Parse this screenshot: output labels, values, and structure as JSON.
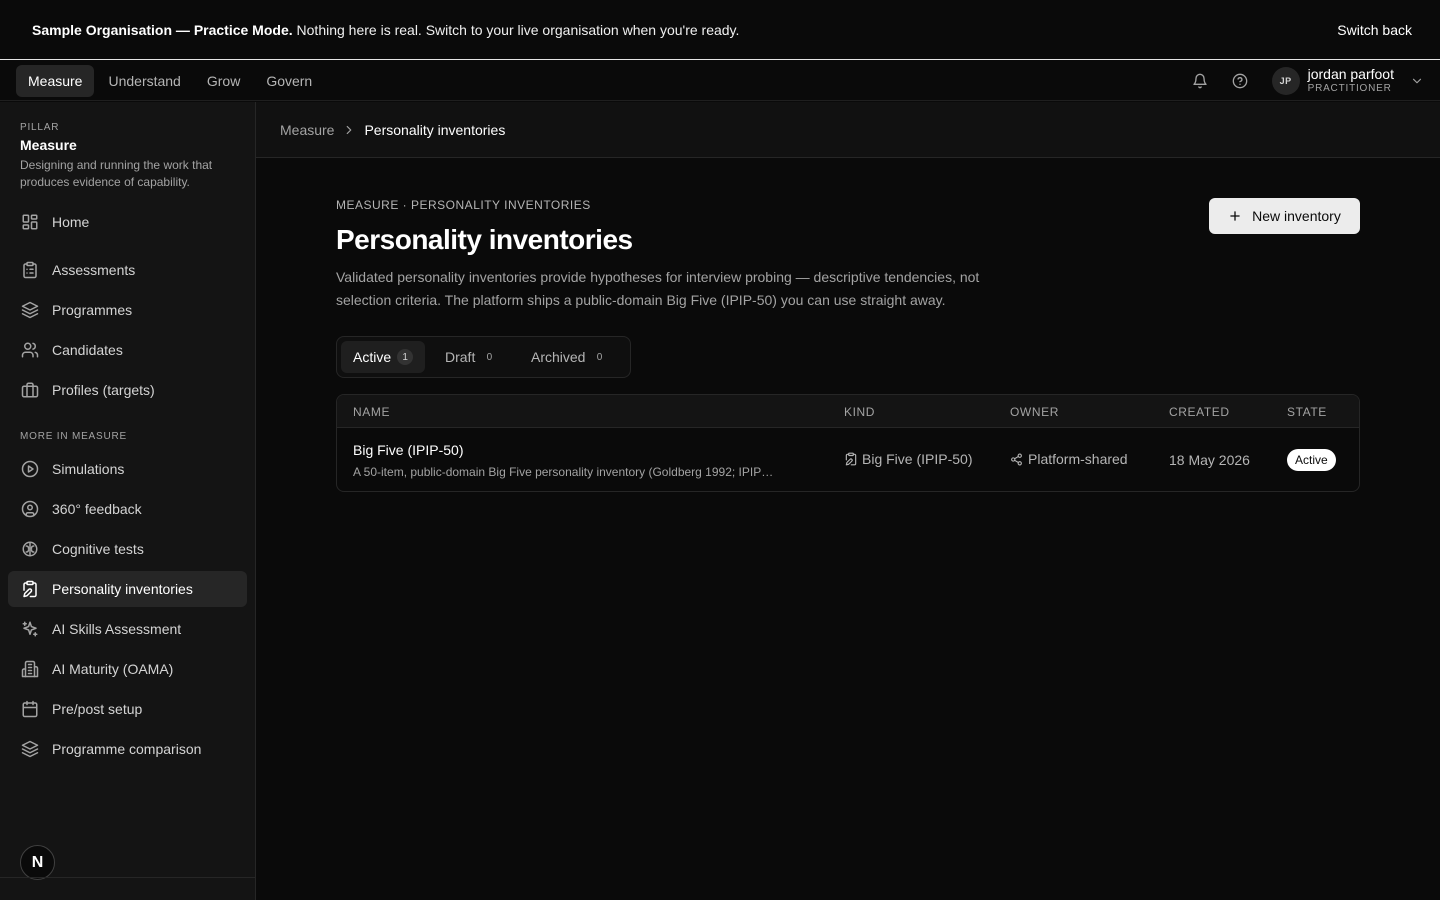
{
  "banner": {
    "strong": "Sample Organisation — Practice Mode.",
    "text": "Nothing here is real. Switch to your live organisation when you're ready.",
    "switch_label": "Switch back"
  },
  "topnav": {
    "pillars": [
      "Measure",
      "Understand",
      "Grow",
      "Govern"
    ],
    "active_pillar": "Measure",
    "user": {
      "initials": "JP",
      "name": "jordan parfoot",
      "role": "PRACTITIONER"
    }
  },
  "sidebar": {
    "kicker": "PILLAR",
    "title": "Measure",
    "description": "Designing and running the work that produces evidence of capability.",
    "primary_items": [
      {
        "label": "Home",
        "icon": "layout-grid-icon"
      },
      {
        "label": "Assessments",
        "icon": "clipboard-list-icon"
      },
      {
        "label": "Programmes",
        "icon": "layers-icon"
      },
      {
        "label": "Candidates",
        "icon": "users-icon"
      },
      {
        "label": "Profiles (targets)",
        "icon": "briefcase-icon"
      }
    ],
    "section_label": "MORE IN MEASURE",
    "more_items": [
      {
        "label": "Simulations",
        "icon": "play-circle-icon"
      },
      {
        "label": "360° feedback",
        "icon": "user-circle-icon"
      },
      {
        "label": "Cognitive tests",
        "icon": "brain-icon"
      },
      {
        "label": "Personality inventories",
        "icon": "clipboard-edit-icon"
      },
      {
        "label": "AI Skills Assessment",
        "icon": "sparkles-icon"
      },
      {
        "label": "AI Maturity (OAMA)",
        "icon": "building-icon"
      },
      {
        "label": "Pre/post setup",
        "icon": "calendar-icon"
      },
      {
        "label": "Programme comparison",
        "icon": "layers-icon"
      }
    ],
    "active_item": "Personality inventories",
    "badge_letter": "N"
  },
  "breadcrumb": {
    "parent": "Measure",
    "current": "Personality inventories"
  },
  "page": {
    "kicker": "MEASURE · PERSONALITY INVENTORIES",
    "title": "Personality inventories",
    "description": "Validated personality inventories provide hypotheses for interview probing — descriptive tendencies, not selection criteria. The platform ships a public-domain Big Five (IPIP-50) you can use straight away.",
    "new_button": "New inventory"
  },
  "tabs": [
    {
      "label": "Active",
      "count": "1"
    },
    {
      "label": "Draft",
      "count": "0"
    },
    {
      "label": "Archived",
      "count": "0"
    }
  ],
  "table": {
    "headers": {
      "name": "NAME",
      "kind": "KIND",
      "owner": "OWNER",
      "created": "CREATED",
      "state": "STATE"
    },
    "rows": [
      {
        "name": "Big Five (IPIP-50)",
        "description": "A 50-item, public-domain Big Five personality inventory (Goldberg 1992; IPIP…",
        "kind": "Big Five (IPIP-50)",
        "owner": "Platform-shared",
        "created": "18 May 2026",
        "state": "Active"
      }
    ]
  }
}
